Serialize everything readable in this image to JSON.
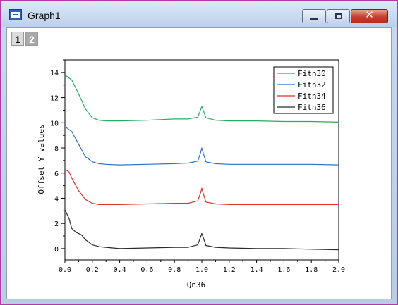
{
  "window": {
    "title": "Graph1"
  },
  "layer_tabs": [
    "1",
    "2"
  ],
  "chart_data": {
    "type": "line",
    "xlabel": "Qn36",
    "ylabel": "Offset Y values",
    "xlim": [
      0,
      2.0
    ],
    "ylim": [
      -0.9,
      15
    ],
    "xticks": [
      "0.0",
      "0.2",
      "0.4",
      "0.6",
      "0.8",
      "1.0",
      "1.2",
      "1.4",
      "1.6",
      "1.8",
      "2.0"
    ],
    "yticks": [
      "0",
      "2",
      "4",
      "6",
      "8",
      "10",
      "12",
      "14"
    ],
    "legend_position": "top-right",
    "series": [
      {
        "name": "Fitn30",
        "color": "#2bab5c",
        "x": [
          0,
          0.05,
          0.1,
          0.15,
          0.2,
          0.25,
          0.3,
          0.4,
          0.6,
          0.8,
          0.9,
          0.97,
          0.99,
          1.0,
          1.01,
          1.03,
          1.1,
          1.2,
          1.4,
          1.6,
          1.8,
          2.0
        ],
        "y": [
          13.8,
          13.4,
          12.3,
          11.1,
          10.4,
          10.2,
          10.15,
          10.15,
          10.2,
          10.3,
          10.3,
          10.45,
          11.0,
          11.3,
          11.0,
          10.4,
          10.2,
          10.15,
          10.15,
          10.1,
          10.1,
          10.05
        ]
      },
      {
        "name": "Fitn32",
        "color": "#2f6fd1",
        "x": [
          0,
          0.05,
          0.1,
          0.15,
          0.2,
          0.25,
          0.3,
          0.4,
          0.6,
          0.8,
          0.9,
          0.97,
          0.99,
          1.0,
          1.01,
          1.03,
          1.1,
          1.2,
          1.4,
          1.6,
          1.8,
          2.0
        ],
        "y": [
          9.7,
          9.3,
          8.3,
          7.3,
          6.9,
          6.75,
          6.7,
          6.65,
          6.7,
          6.75,
          6.8,
          6.95,
          7.6,
          8.0,
          7.6,
          6.9,
          6.75,
          6.7,
          6.7,
          6.7,
          6.7,
          6.65
        ]
      },
      {
        "name": "Fitn34",
        "color": "#e0302a",
        "x": [
          0,
          0.03,
          0.05,
          0.1,
          0.15,
          0.2,
          0.25,
          0.3,
          0.4,
          0.6,
          0.8,
          0.9,
          0.97,
          0.99,
          1.0,
          1.01,
          1.03,
          1.1,
          1.2,
          1.4,
          1.6,
          1.8,
          2.0
        ],
        "y": [
          6.3,
          6.1,
          5.6,
          4.6,
          3.9,
          3.6,
          3.5,
          3.5,
          3.5,
          3.55,
          3.6,
          3.6,
          3.8,
          4.4,
          4.8,
          4.4,
          3.7,
          3.55,
          3.5,
          3.5,
          3.5,
          3.5,
          3.5
        ]
      },
      {
        "name": "Fitn36",
        "color": "#2a2a2a",
        "x": [
          0,
          0.03,
          0.05,
          0.08,
          0.12,
          0.15,
          0.2,
          0.25,
          0.3,
          0.4,
          0.6,
          0.8,
          0.9,
          0.97,
          0.99,
          1.0,
          1.01,
          1.03,
          1.1,
          1.2,
          1.4,
          1.6,
          1.8,
          2.0
        ],
        "y": [
          3.1,
          2.4,
          1.6,
          1.3,
          1.1,
          0.7,
          0.3,
          0.15,
          0.1,
          0.0,
          0.05,
          0.1,
          0.1,
          0.3,
          0.9,
          1.2,
          0.9,
          0.25,
          0.1,
          0.05,
          0.0,
          0.0,
          -0.05,
          -0.1
        ]
      }
    ]
  }
}
